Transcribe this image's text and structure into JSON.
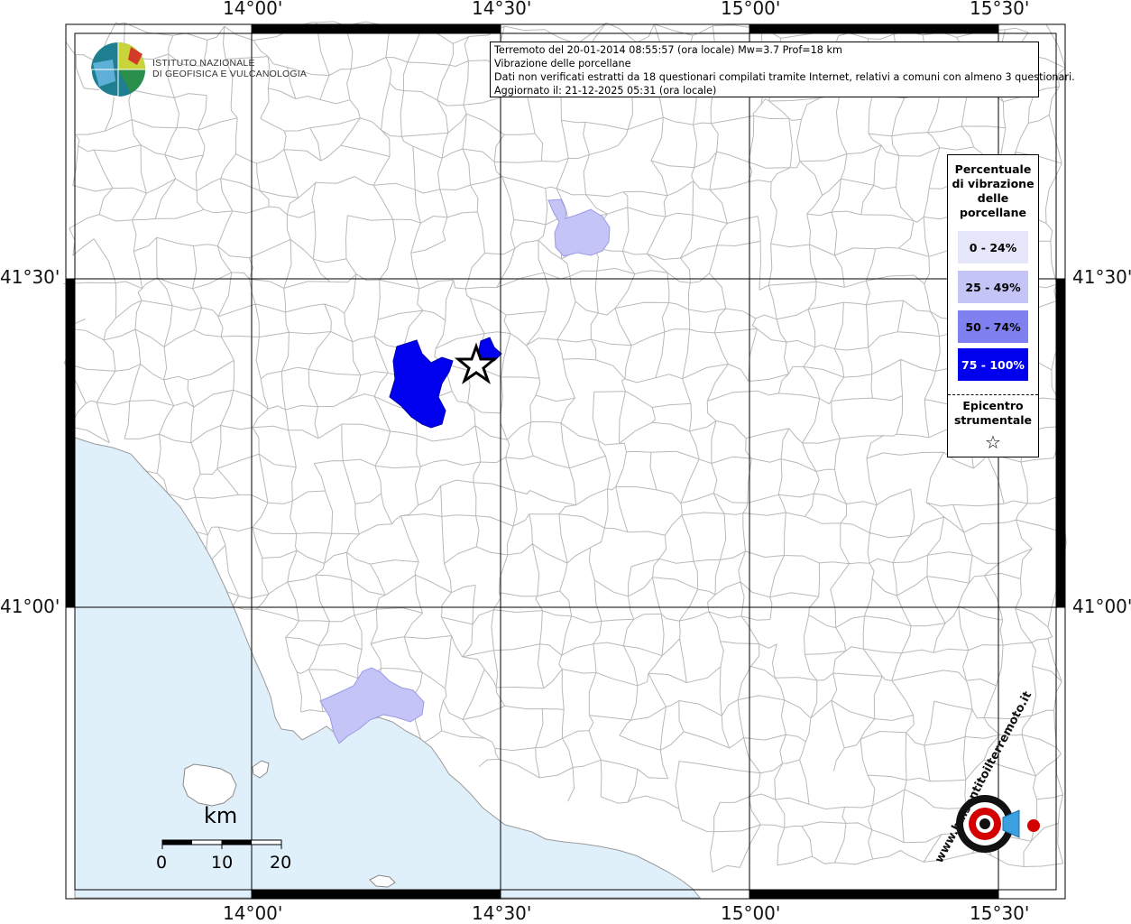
{
  "lon_labels": [
    "14°00'",
    "14°30'",
    "15°00'",
    "15°30'"
  ],
  "lat_labels": [
    "41°30'",
    "41°00'"
  ],
  "info": {
    "line1": "Terremoto del 20-01-2014 08:55:57 (ora locale) Mw=3.7 Prof=18 km",
    "line2": "Vibrazione delle porcellane",
    "line3": "Dati non verificati estratti da 18 questionari compilati tramite Internet, relativi a comuni con almeno 3 questionari.",
    "line4": "Aggiornato il: 21-12-2025 05:31 (ora locale)"
  },
  "legend": {
    "title_lines": [
      "Percentuale",
      "di vibrazione",
      "delle",
      "porcellane"
    ],
    "classes": [
      {
        "label": "0 - 24%",
        "color": "#e6e6fa"
      },
      {
        "label": "25 - 49%",
        "color": "#c4c4f6"
      },
      {
        "label": "50 - 74%",
        "color": "#8080f0"
      },
      {
        "label": "75 - 100%",
        "color": "#0000ee"
      }
    ],
    "epicenter_lines": [
      "Epicentro",
      "strumentale"
    ],
    "epicenter_symbol": "☆"
  },
  "logo": {
    "org_line1": "ISTITUTO NAZIONALE",
    "org_line2": "DI GEOFISICA E VULCANOLOGIA",
    "site_text": "www.haisentitoilterremoto.it"
  },
  "scale": {
    "unit": "km",
    "ticks": [
      "0",
      "10",
      "20"
    ]
  },
  "colors": {
    "sea": "#dff0fb",
    "land": "#ffffff",
    "grid": "#000000",
    "borders": "#b8b8b8"
  }
}
